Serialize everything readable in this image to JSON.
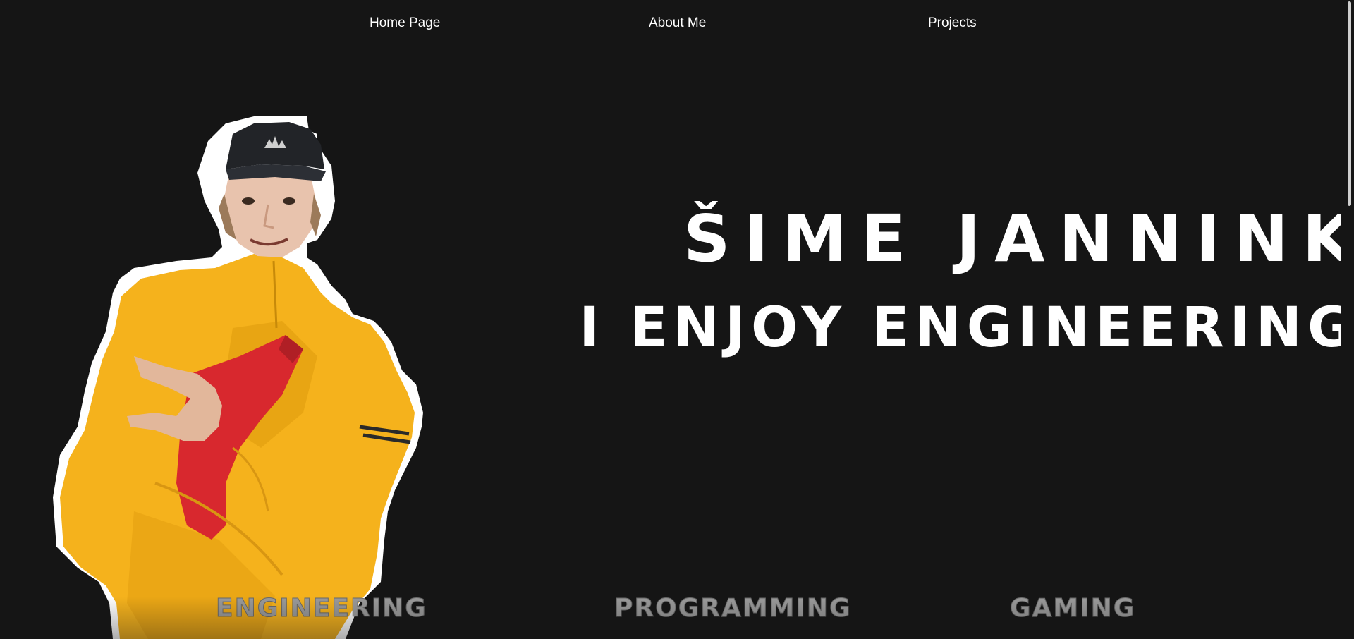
{
  "nav": {
    "home_label": "Home Page",
    "about_label": "About Me",
    "projects_label": "Projects"
  },
  "hero": {
    "name": "ŠIME JANNINK",
    "tagline": "I ENJOY ENGINEERING"
  },
  "interests": [
    {
      "label": "ENGINEERING"
    },
    {
      "label": "PROGRAMMING"
    },
    {
      "label": "GAMING"
    }
  ],
  "colors": {
    "background": "#151515",
    "text": "#ffffff",
    "jacket": "#f5b21c",
    "bag": "#d8282e",
    "cap": "#222428",
    "interest_text": "#9a9a9a"
  },
  "icons": {
    "portrait": "person-portrait-photo"
  }
}
